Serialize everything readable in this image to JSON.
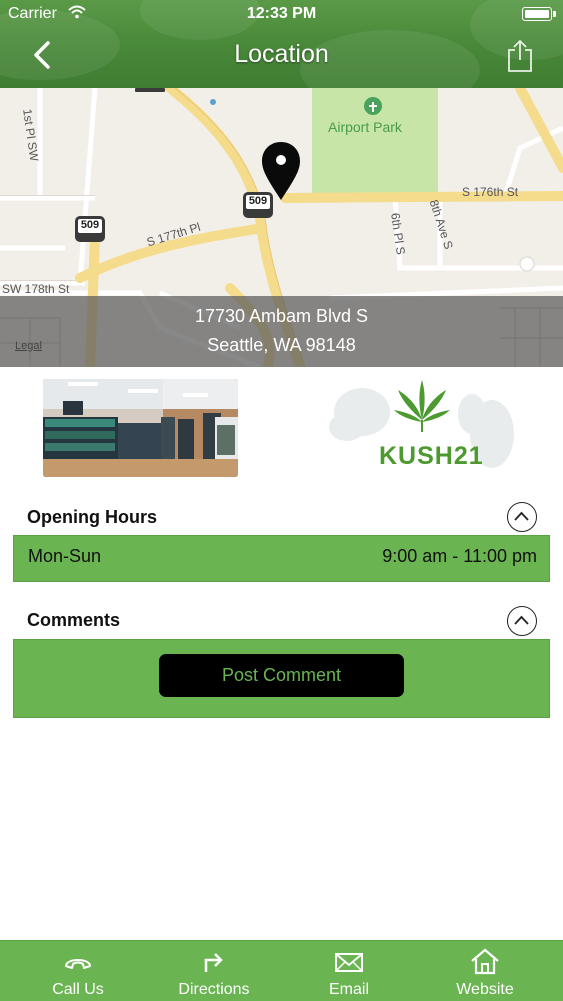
{
  "status_bar": {
    "carrier": "Carrier",
    "time": "12:33 PM"
  },
  "nav": {
    "title": "Location"
  },
  "map": {
    "address_line1": "17730 Ambam Blvd S",
    "address_line2": "Seattle, WA 98148",
    "legal": "Legal",
    "labels": {
      "park": "Airport Park",
      "street_1st": "1st Pl SW",
      "street_176": "S 176th St",
      "street_177": "S 177th Pl",
      "street_178": "SW 178th St",
      "street_6th": "6th Pl S",
      "street_8th": "8th Ave S",
      "route_shield": "509"
    }
  },
  "logo": {
    "text": "KUSH21"
  },
  "opening_hours": {
    "title": "Opening Hours",
    "rows": [
      {
        "day": "Mon-Sun",
        "time": "9:00 am - 11:00 pm"
      }
    ]
  },
  "comments": {
    "title": "Comments",
    "post_button": "Post Comment"
  },
  "tabbar": {
    "items": [
      {
        "label": "Call Us",
        "icon": "phone-icon"
      },
      {
        "label": "Directions",
        "icon": "directions-icon"
      },
      {
        "label": "Email",
        "icon": "envelope-icon"
      },
      {
        "label": "Website",
        "icon": "home-icon"
      }
    ]
  },
  "colors": {
    "nav_green": "#4a8a3a",
    "accent_green": "#6ab552",
    "button_black": "#000000",
    "park_green": "#c6e5a7"
  }
}
